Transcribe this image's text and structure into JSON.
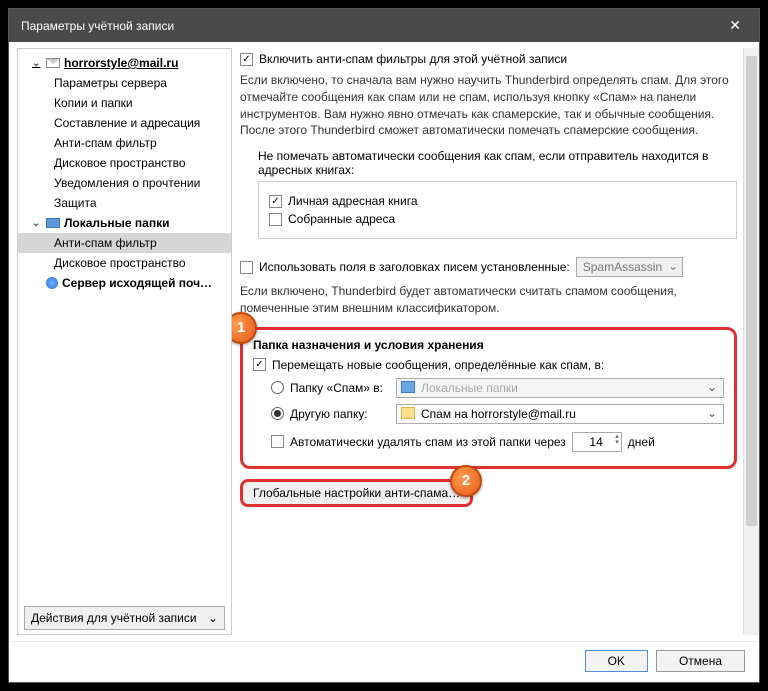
{
  "window": {
    "title": "Параметры учётной записи"
  },
  "sidebar": {
    "account_email": "horrorstyle@mail.ru",
    "items": [
      "Параметры сервера",
      "Копии и папки",
      "Составление и адресация",
      "Анти-спам фильтр",
      "Дисковое пространство",
      "Уведомления о прочтении",
      "Защита"
    ],
    "local_folders": "Локальные папки",
    "local_items": [
      "Анти-спам фильтр",
      "Дисковое пространство"
    ],
    "outgoing": "Сервер исходящей поч…",
    "actions_label": "Действия для учётной записи"
  },
  "main": {
    "enable_label": "Включить анти-спам фильтры для этой учётной записи",
    "enable_desc": "Если включено, то сначала вам нужно научить Thunderbird определять спам. Для этого отмечайте сообщения как спам или не спам, используя кнопку «Спам» на панели инструментов. Вам нужно явно отмечать как спамерские, так и обычные сообщения. После этого Thunderbird сможет автоматически помечать спамерские сообщения.",
    "ab_intro": "Не помечать автоматически сообщения как спам, если отправитель находится в адресных книгах:",
    "ab_personal": "Личная адресная книга",
    "ab_collected": "Собранные адреса",
    "headers_label": "Использовать поля в заголовках писем установленные:",
    "headers_value": "SpamAssassin",
    "headers_desc": "Если включено, Thunderbird будет автоматически считать спамом сообщения, помеченные этим внешним классификатором.",
    "dest_title": "Папка назначения и условия хранения",
    "move_label": "Перемещать новые сообщения, определённые как спам, в:",
    "radio_spam": "Папку «Спам» в:",
    "radio_spam_value": "Локальные папки",
    "radio_other": "Другую папку:",
    "radio_other_value": "Спам на horrorstyle@mail.ru",
    "auto_delete": "Автоматически удалять спам из этой папки через",
    "auto_delete_days": "14",
    "auto_delete_suffix": "дней",
    "global_btn": "Глобальные настройки анти-спама…"
  },
  "callouts": {
    "one": "1",
    "two": "2"
  },
  "footer": {
    "ok": "OK",
    "cancel": "Отмена"
  }
}
